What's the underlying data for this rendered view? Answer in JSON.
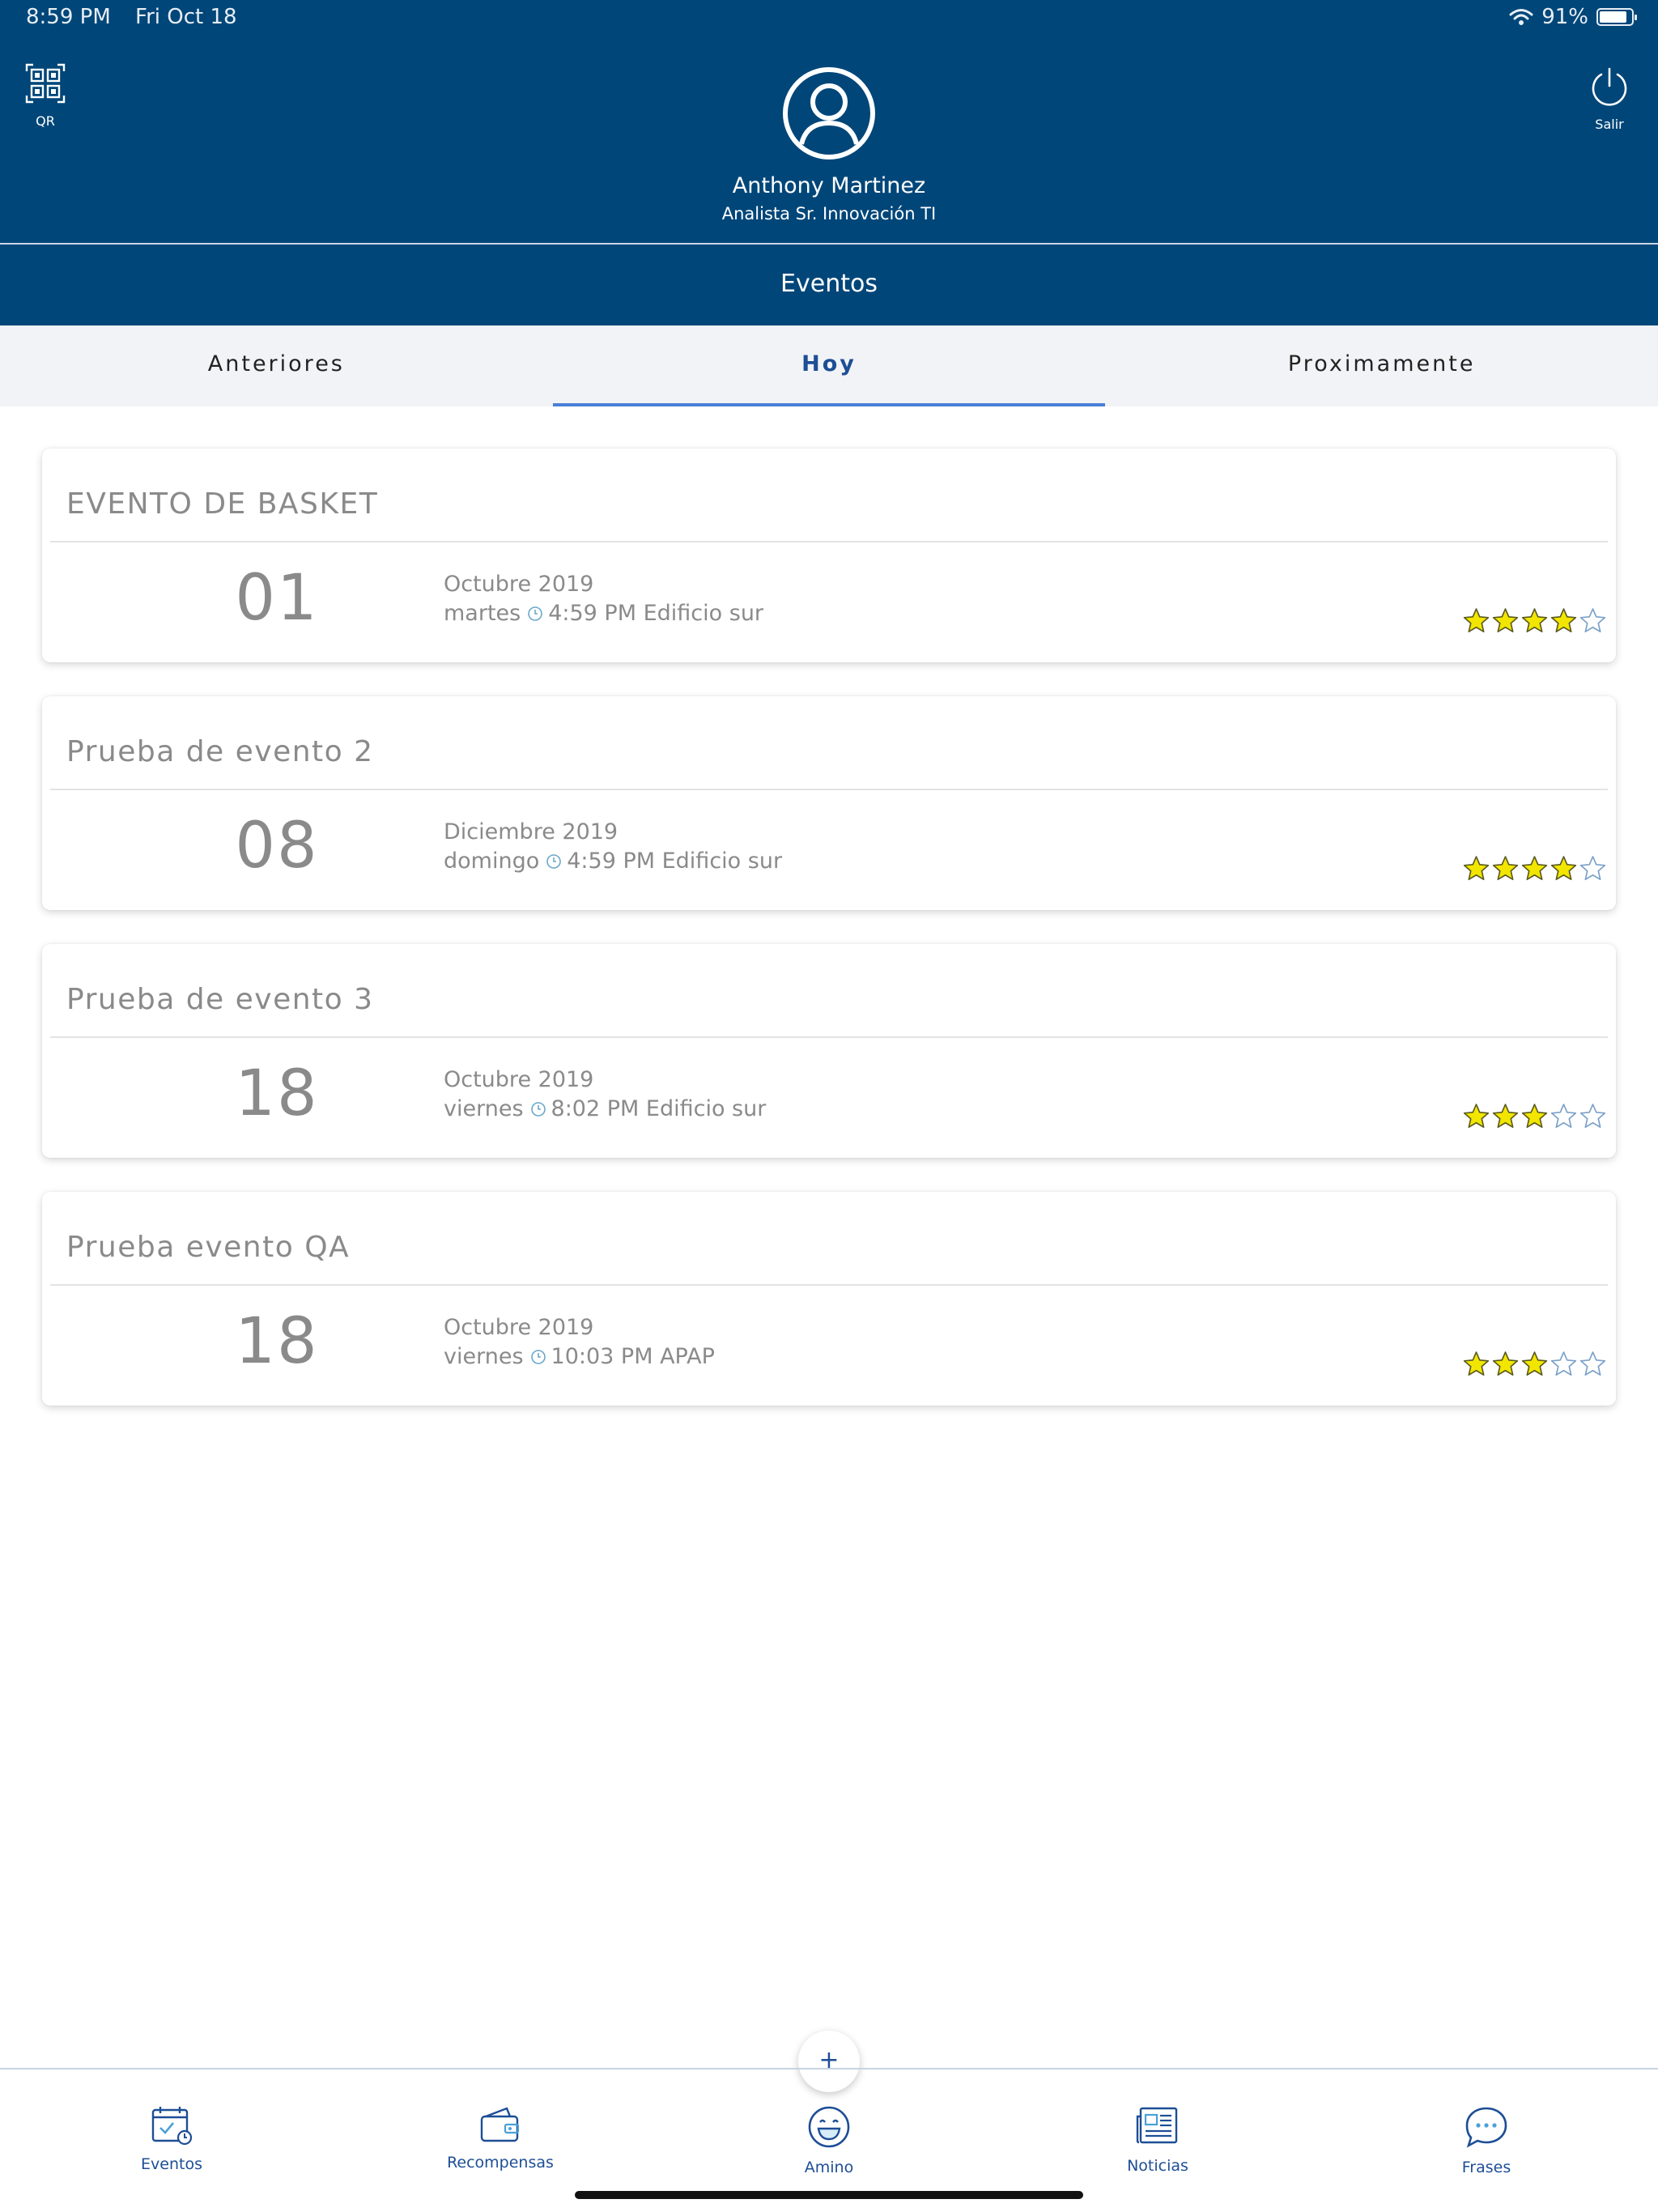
{
  "status_bar": {
    "time": "8:59 PM",
    "date": "Fri Oct 18",
    "battery": "91%",
    "battery_level": 0.91
  },
  "header": {
    "qr_label": "QR",
    "exit_label": "Salir",
    "user_name": "Anthony Martinez",
    "user_role": "Analista Sr. Innovación TI",
    "section_title": "Eventos"
  },
  "tabs": [
    {
      "label": "Anteriores",
      "active": false
    },
    {
      "label": "Hoy",
      "active": true
    },
    {
      "label": "Proximamente",
      "active": false
    }
  ],
  "events": [
    {
      "title": "EVENTO DE BASKET",
      "day": "01",
      "month": "Octubre 2019",
      "weekday": "martes",
      "time_place": "4:59 PM Edificio sur",
      "rating": 4,
      "max_rating": 5
    },
    {
      "title": "Prueba de evento 2",
      "day": "08",
      "month": "Diciembre 2019",
      "weekday": "domingo",
      "time_place": "4:59 PM Edificio sur",
      "rating": 4,
      "max_rating": 5
    },
    {
      "title": "Prueba de evento 3",
      "day": "18",
      "month": "Octubre 2019",
      "weekday": "viernes",
      "time_place": "8:02 PM Edificio sur",
      "rating": 3,
      "max_rating": 5
    },
    {
      "title": "Prueba evento QA",
      "day": "18",
      "month": "Octubre 2019",
      "weekday": "viernes",
      "time_place": "10:03 PM APAP",
      "rating": 3,
      "max_rating": 5
    }
  ],
  "fab_label": "+",
  "nav": [
    {
      "label": "Eventos",
      "icon": "calendar-icon"
    },
    {
      "label": "Recompensas",
      "icon": "wallet-icon"
    },
    {
      "label": "Amino",
      "icon": "smile-icon"
    },
    {
      "label": "Noticias",
      "icon": "newspaper-icon"
    },
    {
      "label": "Frases",
      "icon": "chat-bubble-icon"
    }
  ],
  "colors": {
    "primary": "#004679",
    "accent": "#4a7fd7",
    "nav_text": "#1d4e96",
    "star": "#f2e600",
    "star_outline": "#7aa0c8"
  }
}
